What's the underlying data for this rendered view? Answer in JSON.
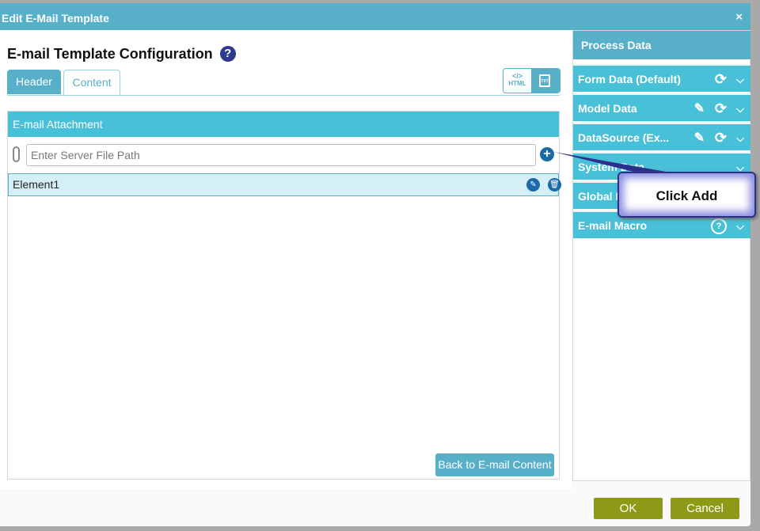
{
  "dialog": {
    "title": "Edit E-Mail Template",
    "close_glyph": "×"
  },
  "main": {
    "heading": "E-mail Template Configuration",
    "help_glyph": "?",
    "tabs": [
      {
        "label": "Header",
        "active": false
      },
      {
        "label": "Content",
        "active": true
      }
    ],
    "format_toggle": {
      "html_label": "HTML",
      "html_glyph": "</>",
      "txt_label": "TXT"
    },
    "attachment_panel": {
      "title": "E-mail Attachment",
      "path_placeholder": "Enter Server File Path",
      "path_value": "",
      "add_glyph": "+",
      "items": [
        {
          "label": "Element1"
        }
      ],
      "back_button": "Back to E-mail Content"
    }
  },
  "process_data": {
    "title": "Process Data",
    "items": [
      {
        "label": "Form Data (Default)",
        "icons": [
          "refresh-icon",
          "chevron-down-icon"
        ]
      },
      {
        "label": "Model Data",
        "icons": [
          "pencil-icon",
          "refresh-icon",
          "chevron-down-icon"
        ]
      },
      {
        "label": "DataSource (Ex...",
        "icons": [
          "pencil-icon",
          "refresh-icon",
          "chevron-down-icon"
        ]
      },
      {
        "label": "System Data",
        "icons": [
          "chevron-down-icon"
        ]
      },
      {
        "label": "Global Data",
        "icons": [
          "chevron-down-icon"
        ]
      },
      {
        "label": "E-mail Macro",
        "icons": [
          "help-icon",
          "chevron-down-icon"
        ]
      }
    ]
  },
  "callout": {
    "text": "Click Add"
  },
  "footer": {
    "ok": "OK",
    "cancel": "Cancel"
  },
  "colors": {
    "accent": "#58afc8",
    "header_bar": "#48c0d8",
    "footer_button": "#8c9a17",
    "icon_blue": "#1b6aa8"
  }
}
